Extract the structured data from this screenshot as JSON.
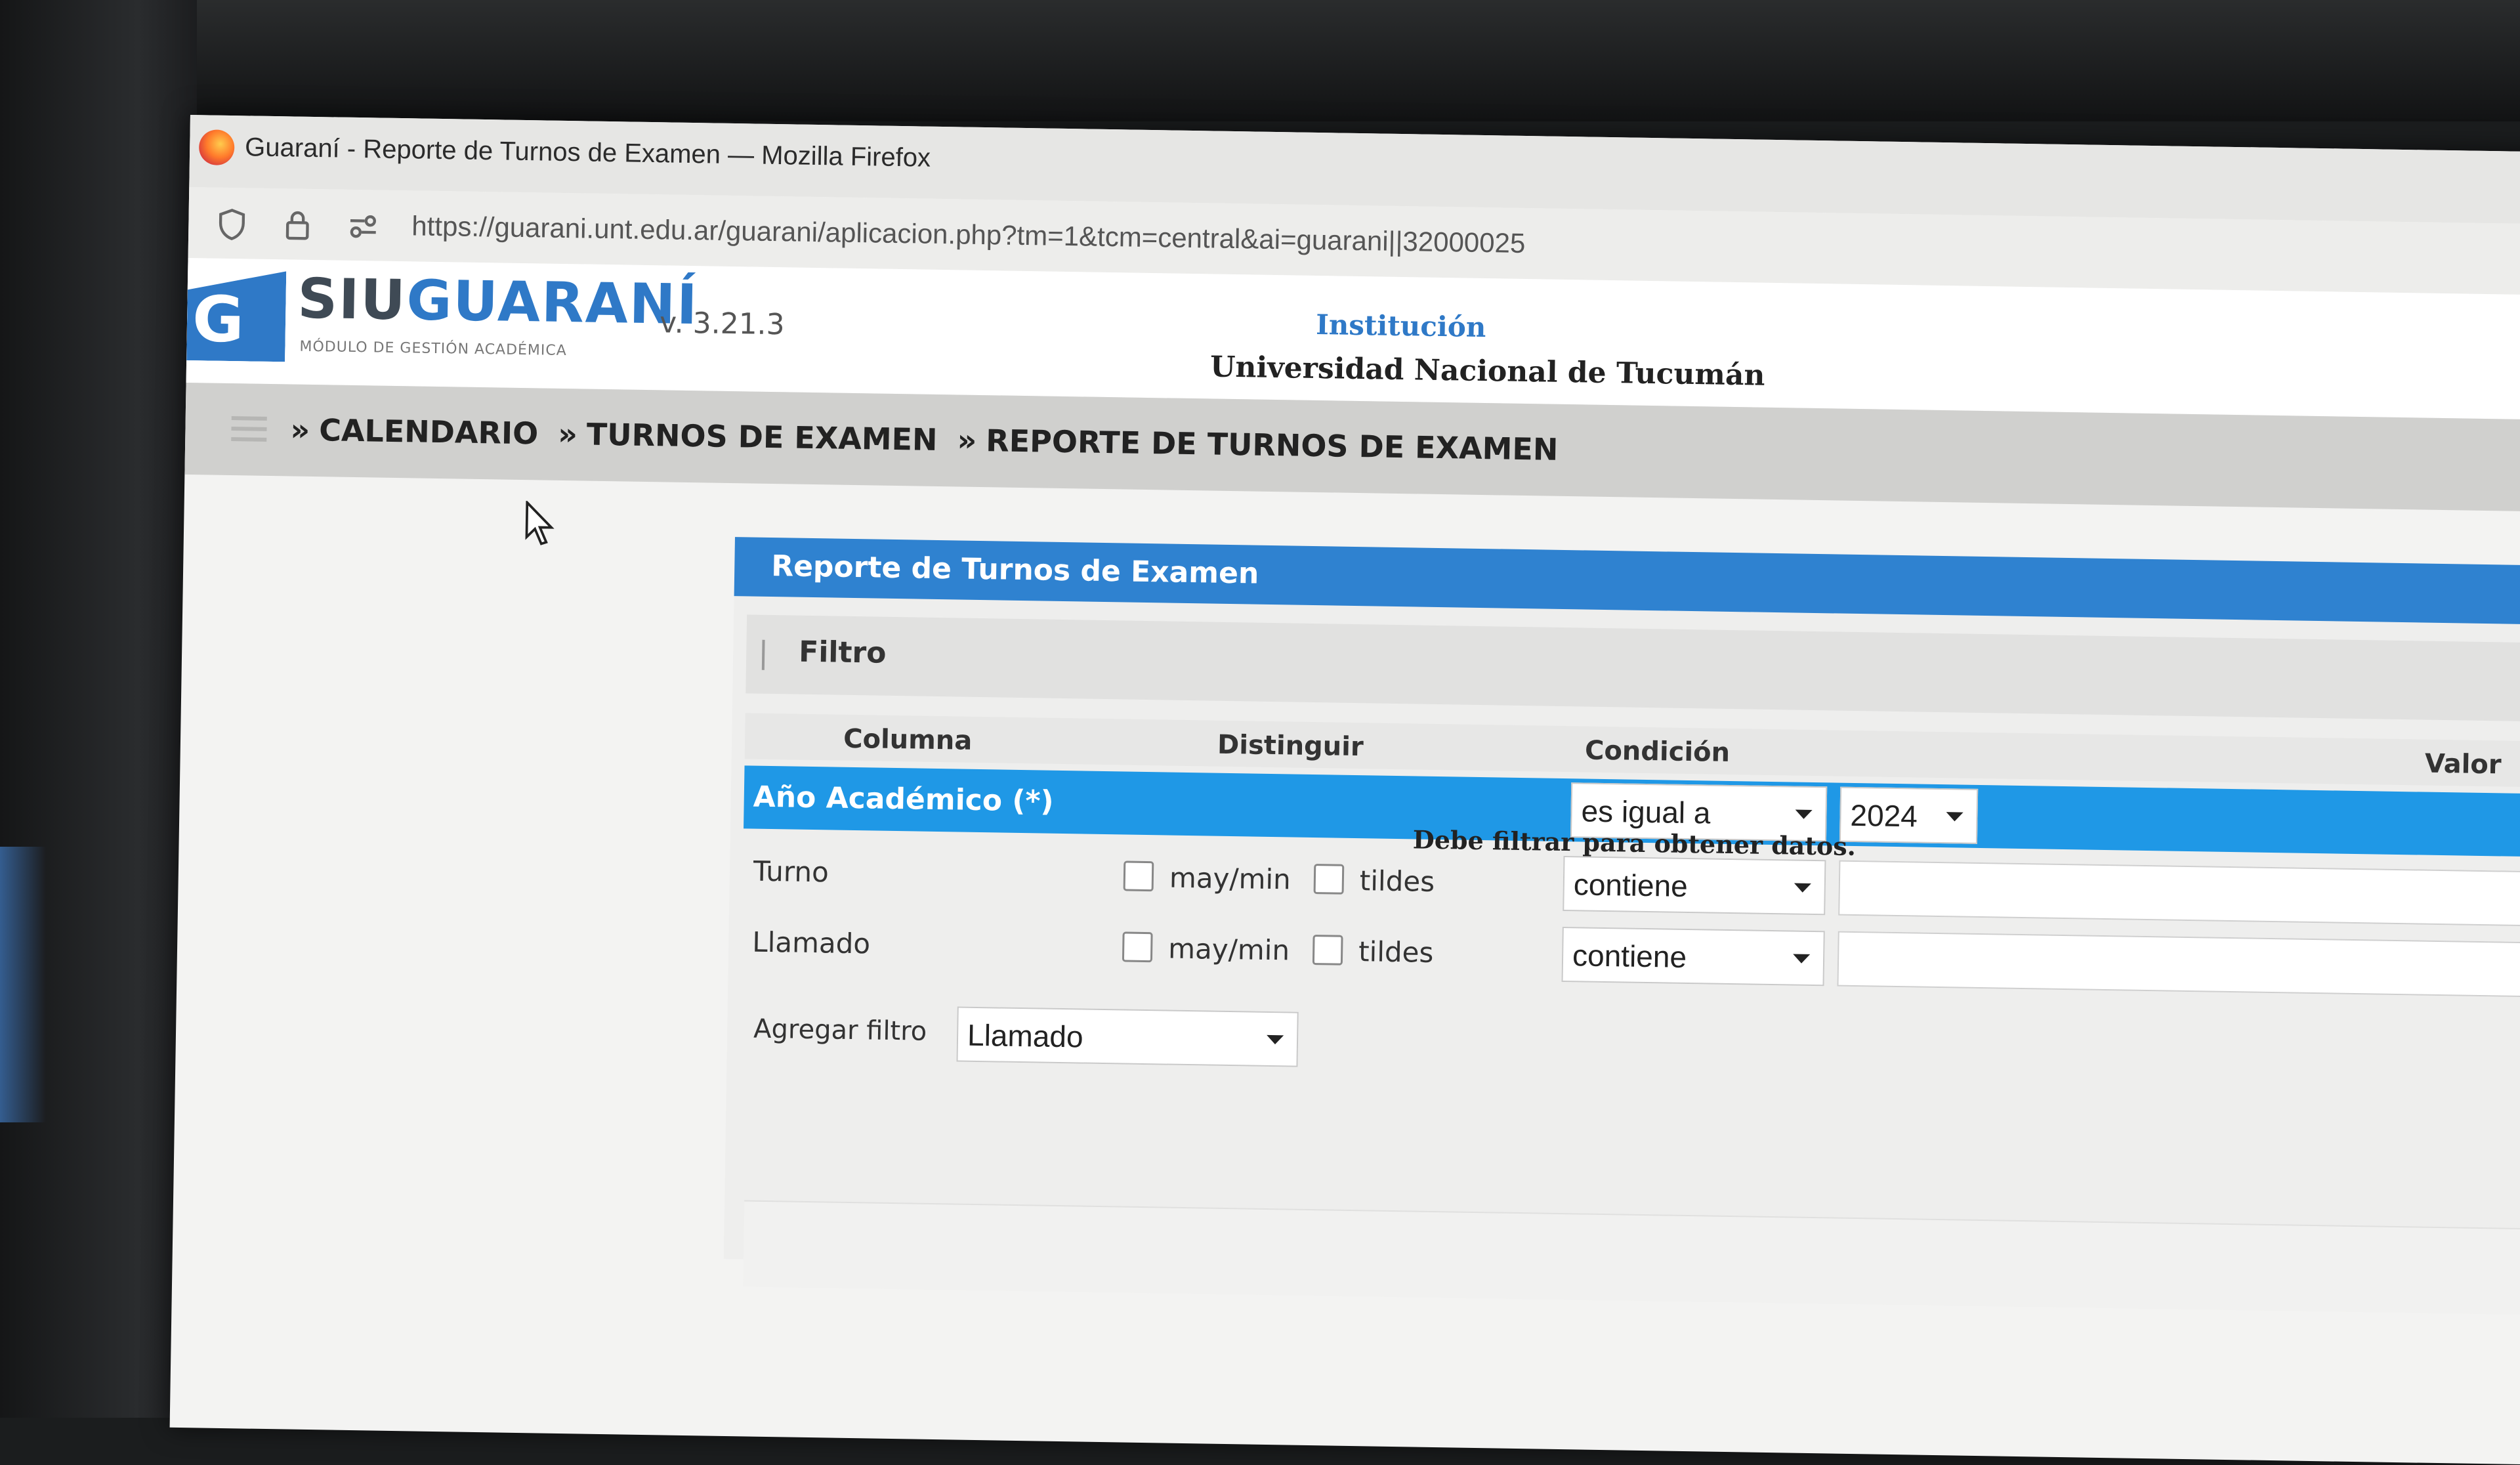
{
  "window": {
    "title": "Guaraní - Reporte de Turnos de Examen — Mozilla Firefox",
    "url": "https://guarani.unt.edu.ar/guarani/aplicacion.php?tm=1&tcm=central&ai=guarani||32000025"
  },
  "header": {
    "brand_siu": "SIU",
    "brand_guarani": "GUARANÍ",
    "brand_subtitle": "MÓDULO DE GESTIÓN ACADÉMICA",
    "version": "v. 3.21.3",
    "institution_label": "Institución",
    "institution_name": "Universidad Nacional de Tucumán"
  },
  "breadcrumb": {
    "items": [
      "CALENDARIO",
      "TURNOS DE EXAMEN",
      "REPORTE DE TURNOS DE EXAMEN"
    ],
    "separator": "»"
  },
  "panel": {
    "title": "Reporte de Turnos de Examen",
    "filter_title": "Filtro",
    "columns": {
      "columna": "Columna",
      "distinguir": "Distinguir",
      "condicion": "Condición",
      "valor": "Valor"
    },
    "rows": [
      {
        "label": "Año Académico (*)",
        "condition": "es igual a",
        "value": "2024"
      },
      {
        "label": "Turno",
        "case_label": "may/min",
        "accent_label": "tildes",
        "condition": "contiene",
        "value": ""
      },
      {
        "label": "Llamado",
        "case_label": "may/min",
        "accent_label": "tildes",
        "condition": "contiene",
        "value": ""
      }
    ],
    "add_filter_label": "Agregar filtro",
    "add_filter_value": "Llamado",
    "no_data_message": "Debe filtrar para obtener datos."
  },
  "colors": {
    "accent": "#2f79c7",
    "panel_header": "#2f82d0",
    "selected_row": "#1f98e6"
  }
}
